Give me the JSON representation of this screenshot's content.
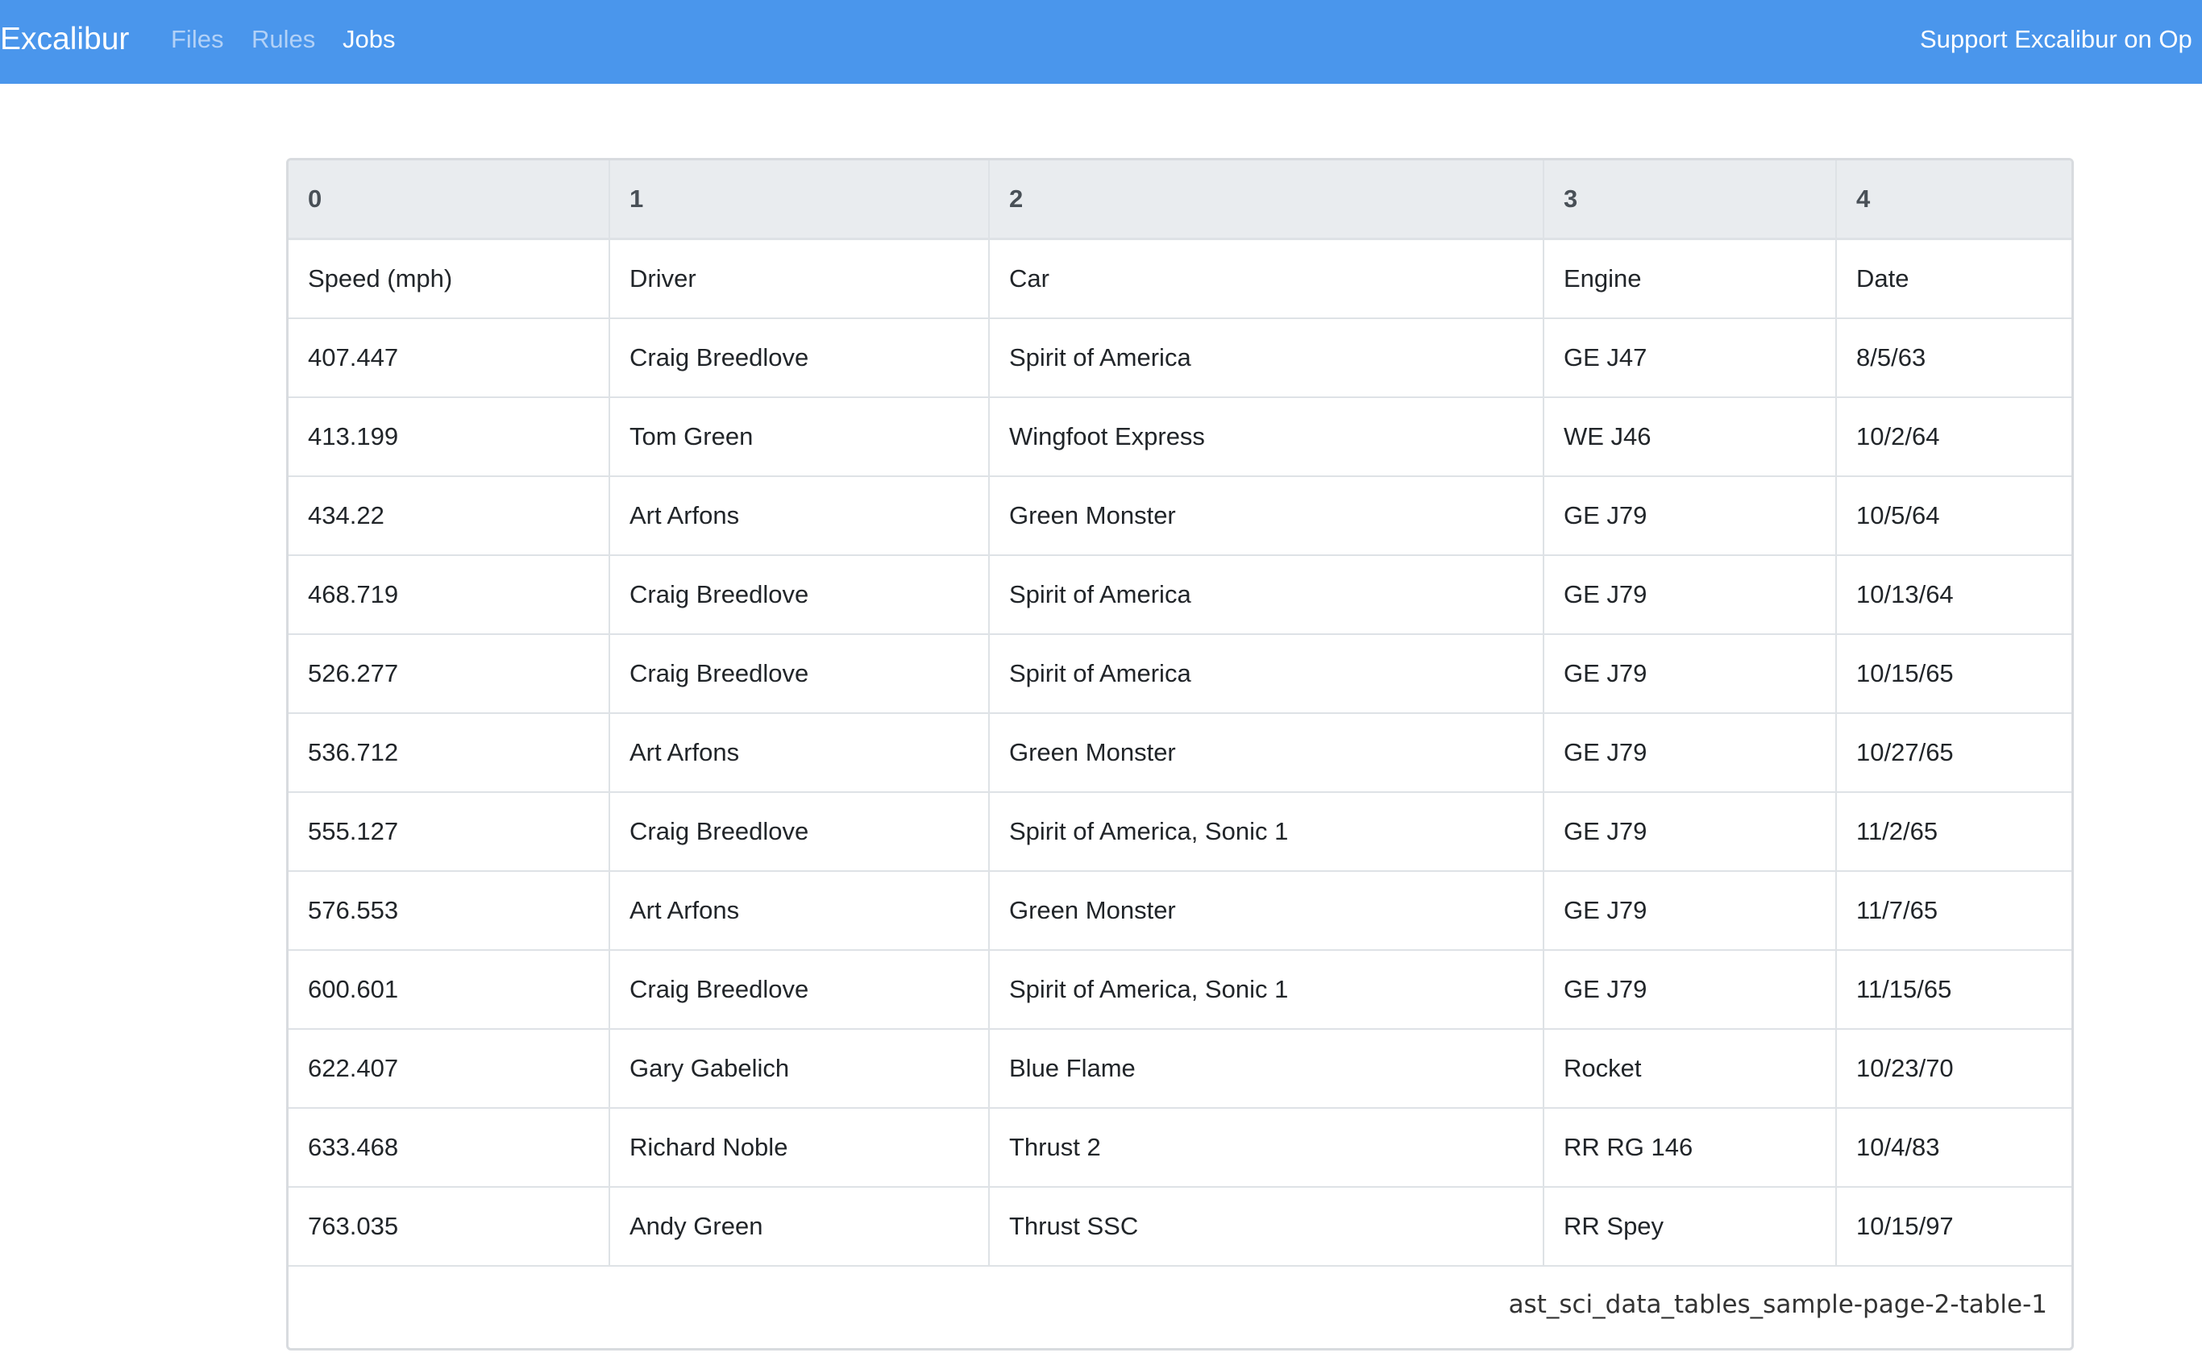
{
  "navbar": {
    "brand": "Excalibur",
    "links": [
      {
        "label": "Files"
      },
      {
        "label": "Rules"
      },
      {
        "label": "Jobs"
      }
    ],
    "support": "Support Excalibur on Op",
    "bg_color": "#4a96ec"
  },
  "table": {
    "headers": [
      "0",
      "1",
      "2",
      "3",
      "4"
    ],
    "rows": [
      [
        "Speed (mph)",
        "Driver",
        "Car",
        "Engine",
        "Date"
      ],
      [
        "407.447",
        "Craig Breedlove",
        "Spirit of America",
        "GE J47",
        "8/5/63"
      ],
      [
        "413.199",
        "Tom Green",
        "Wingfoot Express",
        "WE J46",
        "10/2/64"
      ],
      [
        "434.22",
        "Art Arfons",
        "Green Monster",
        "GE J79",
        "10/5/64"
      ],
      [
        "468.719",
        "Craig Breedlove",
        "Spirit of America",
        "GE J79",
        "10/13/64"
      ],
      [
        "526.277",
        "Craig Breedlove",
        "Spirit of America",
        "GE J79",
        "10/15/65"
      ],
      [
        "536.712",
        "Art Arfons",
        "Green Monster",
        "GE J79",
        "10/27/65"
      ],
      [
        "555.127",
        "Craig Breedlove",
        "Spirit of America, Sonic 1",
        "GE J79",
        "11/2/65"
      ],
      [
        "576.553",
        "Art Arfons",
        "Green Monster",
        "GE J79",
        "11/7/65"
      ],
      [
        "600.601",
        "Craig Breedlove",
        "Spirit of America, Sonic 1",
        "GE J79",
        "11/15/65"
      ],
      [
        "622.407",
        "Gary Gabelich",
        "Blue Flame",
        "Rocket",
        "10/23/70"
      ],
      [
        "633.468",
        "Richard Noble",
        "Thrust 2",
        "RR RG 146",
        "10/4/83"
      ],
      [
        "763.035",
        "Andy Green",
        "Thrust SSC",
        "RR Spey",
        "10/15/97"
      ]
    ],
    "caption": "ast_sci_data_tables_sample-page-2-table-1"
  }
}
